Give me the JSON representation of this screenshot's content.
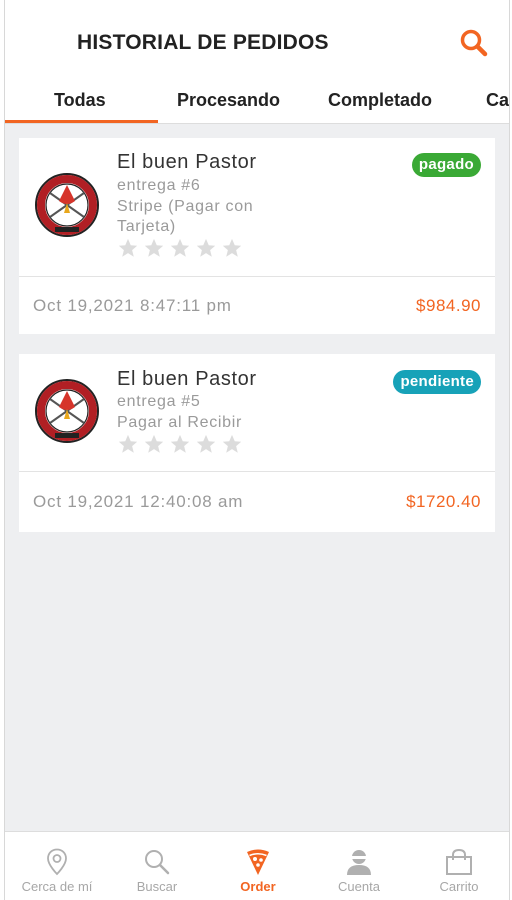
{
  "header": {
    "title": "HISTORIAL DE PEDIDOS",
    "search_icon": "search-icon"
  },
  "tabs": [
    {
      "label": "Todas",
      "active": true
    },
    {
      "label": "Procesando"
    },
    {
      "label": "Completado"
    },
    {
      "label": "Ca"
    }
  ],
  "orders": [
    {
      "store": "El buen Pastor",
      "order_no": "entrega #6",
      "payment": "Stripe (Pagar con Tarjeta)",
      "rating": 0,
      "status": "pagado",
      "status_color": "#3aa935",
      "date": "Oct 19,2021 8:47:11 pm",
      "total": "$984.90"
    },
    {
      "store": "El buen Pastor",
      "order_no": "entrega #5",
      "payment": "Pagar al Recibir",
      "rating": 0,
      "status": "pendiente",
      "status_color": "#17a2b8",
      "date": "Oct 19,2021 12:40:08 am",
      "total": "$1720.40"
    }
  ],
  "bottom_nav": [
    {
      "label": "Cerca de mí",
      "icon": "location-pin-icon"
    },
    {
      "label": "Buscar",
      "icon": "search-icon"
    },
    {
      "label": "Order",
      "icon": "pizza-icon",
      "active": true
    },
    {
      "label": "Cuenta",
      "icon": "user-icon"
    },
    {
      "label": "Carrito",
      "icon": "shopping-bag-icon"
    }
  ],
  "colors": {
    "accent": "#f26522",
    "background": "#eeeff1",
    "paid": "#3aa935",
    "pending": "#17a2b8"
  }
}
